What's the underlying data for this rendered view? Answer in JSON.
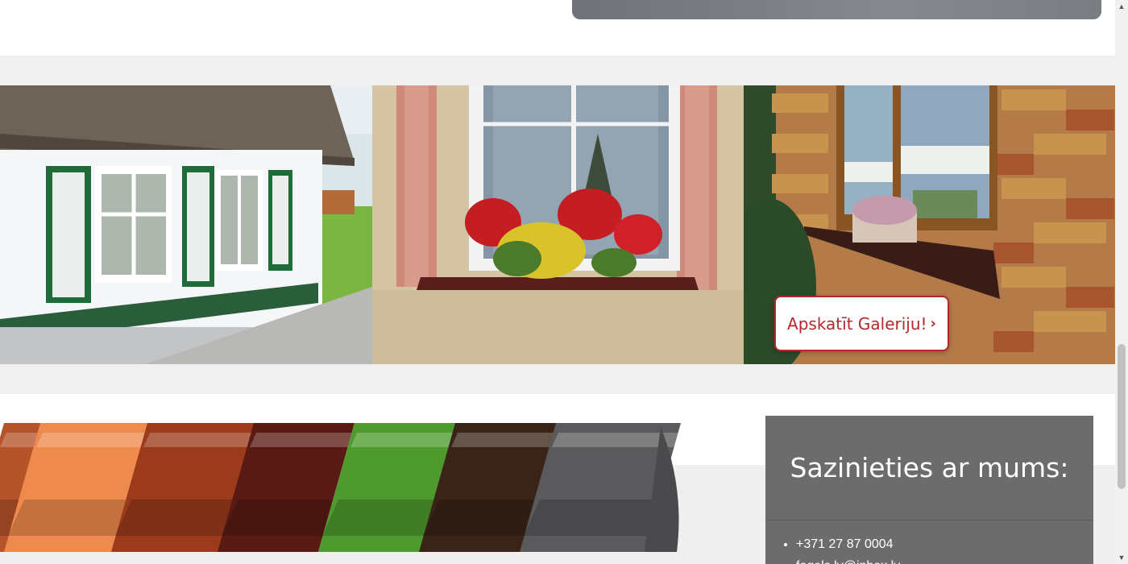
{
  "gallery": {
    "button_label": "Apskatīt Galeriju!",
    "button_icon": "chevron-right-icon",
    "accent_color": "#b5272c"
  },
  "sill_colors": [
    "#b5542a",
    "#ee8a4e",
    "#9c3a1c",
    "#5a1a14",
    "#4f9a2e",
    "#3a2418",
    "#5a5a5c"
  ],
  "contact": {
    "title": "Sazinieties ar mums:",
    "items": [
      "+371 27 87 0004",
      "fogels.lv@inbox.lv"
    ]
  },
  "scrollbar": {
    "up_icon": "triangle-up-icon",
    "down_icon": "triangle-down-icon"
  }
}
